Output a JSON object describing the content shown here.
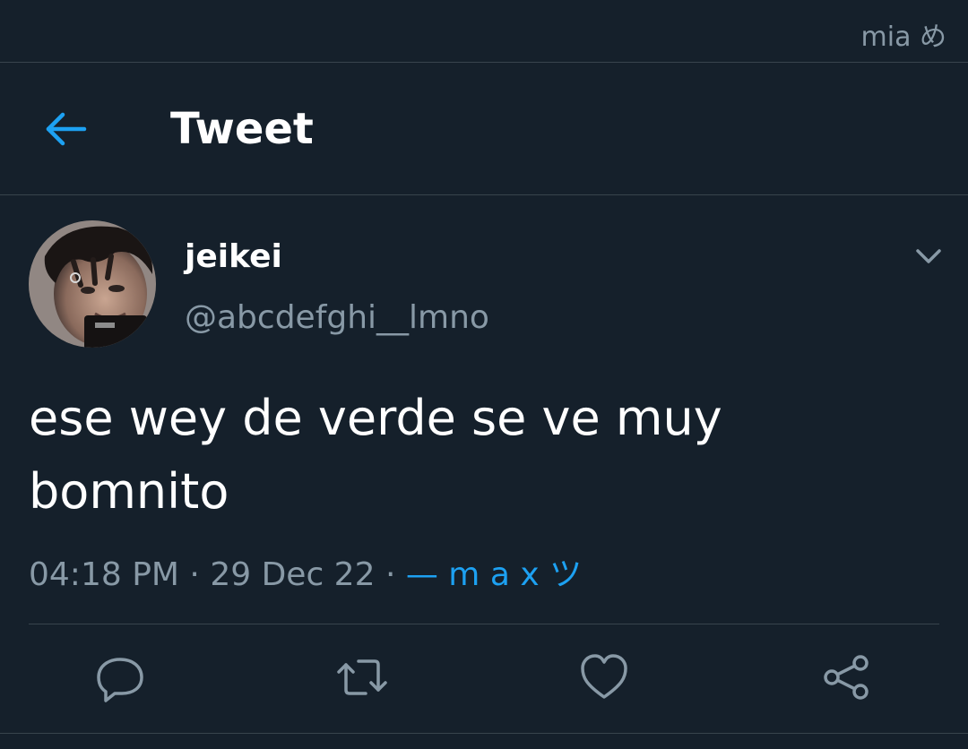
{
  "status_bar": {
    "text": "mia め"
  },
  "header": {
    "title": "Tweet",
    "back_icon": "arrow-left-icon"
  },
  "tweet": {
    "author": {
      "display_name": "jeikei",
      "handle": "@abcdefghi__lmno"
    },
    "text": "ese wey de verde se ve muy bomnito",
    "time": "04:18 PM",
    "date": "29 Dec 22",
    "source": "— m a x ツ",
    "separator": "·"
  },
  "actions": {
    "icons": [
      "reply-icon",
      "retweet-icon",
      "like-icon",
      "share-icon"
    ]
  },
  "colors": {
    "background": "#15202b",
    "accent": "#1da1f2",
    "secondary_text": "#8899a6",
    "border": "#38444d"
  }
}
